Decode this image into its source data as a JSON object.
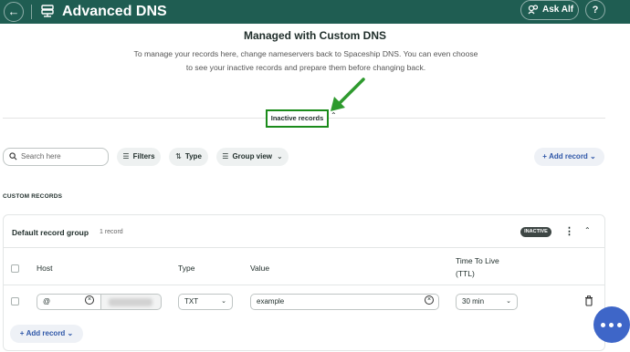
{
  "header": {
    "back_icon": "arrow-left-icon",
    "app_icon": "dns-server-icon",
    "title": "Advanced DNS",
    "ask_label": "Ask Alf",
    "help_icon": "question-circle-icon",
    "bar_color": "#1f5d52"
  },
  "notice": {
    "title": "Managed with Custom DNS",
    "description": "To manage your records here, change nameservers back to Spaceship DNS. You can even choose to see your inactive records and prepare them before changing back."
  },
  "inactive_toggle": {
    "label": "Inactive records",
    "highlight_color": "#1b8b1b"
  },
  "toolbar": {
    "search_placeholder": "Search here",
    "filters_label": "Filters",
    "type_label": "Type",
    "group_view_label": "Group view",
    "add_record_label": "Add record"
  },
  "section_label": "CUSTOM RECORDS",
  "record_group": {
    "name": "Default record group",
    "count": "1 record",
    "badge": "INACTIVE",
    "columns": {
      "host": "Host",
      "type": "Type",
      "value": "Value",
      "ttl_line1": "Time To Live",
      "ttl_line2": "(TTL)"
    },
    "rows": [
      {
        "host": "@",
        "type": "TXT",
        "value": "example",
        "ttl": "30 min"
      }
    ],
    "add_record_label": "Add record"
  },
  "colors": {
    "accent_blue": "#2f57a8",
    "chat_blue": "#3e66c8"
  }
}
